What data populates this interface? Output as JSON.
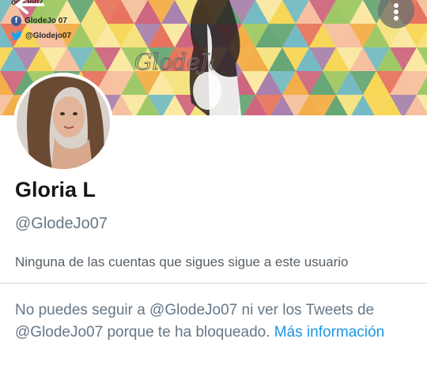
{
  "banner": {
    "signature": "GlodeJo",
    "social": {
      "top_partial": "odeJo07",
      "facebook": "GlodeJo 07",
      "twitter": "@Glodejo07"
    }
  },
  "profile": {
    "display_name": "Gloria L",
    "handle": "@GlodeJo07",
    "followers_note": "Ninguna de las cuentas que sigues sigue a este usuario"
  },
  "blocked": {
    "message": "No puedes seguir a @GlodeJo07 ni ver los Tweets de @GlodeJo07 porque te ha bloqueado.",
    "link": "Más información"
  },
  "colors": {
    "link": "#1b95e0",
    "name": "#14171a",
    "muted": "#657786"
  }
}
